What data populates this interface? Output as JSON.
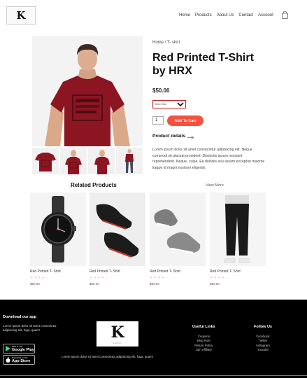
{
  "header": {
    "logo_text": "K",
    "nav": [
      "Home",
      "Products",
      "About Us",
      "Contact",
      "Account"
    ],
    "cart_icon": "shopping-bag-icon"
  },
  "product": {
    "breadcrumb": "Home / T- shirt",
    "title": "Red Printed T-Shirt by HRX",
    "price": "$50.00",
    "size_select": "Select Size",
    "quantity": "1",
    "add_to_cart": "Add To Cart",
    "details_heading": "Product details",
    "description": "Lorem ipsum dolor sit amet consectetur adipisicing elit. Neque commodi sit placeat provident! Distinctio ipsum nesciunt reprehenderit. Neque, culpa. Ea dolores eius ipsam excepturi maxime itaque id magni nostrum eligendi.",
    "colors": {
      "shirt": "#8c1522",
      "accent": "#f4513e",
      "select_border": "#c62828"
    }
  },
  "related": {
    "title": "Related Products",
    "view_more": "View More",
    "items": [
      {
        "name": "Red Printed T- Shirt",
        "price": "$50.00",
        "rating": 4
      },
      {
        "name": "Red Printed T- Shirt",
        "price": "$50.00",
        "rating": 4
      },
      {
        "name": "Red Printed T- Shirt",
        "price": "$50.00",
        "rating": 4
      },
      {
        "name": "Red Printed T- Shirt",
        "price": "$50.00",
        "rating": 4
      }
    ]
  },
  "footer": {
    "app_heading": "Download our app",
    "app_text": "Lorem ipsum dolor sit amet consectetur adipisicing elit, fuga, quam!",
    "google_play_small": "GET IT ON",
    "google_play": "Google Play",
    "app_store_small": "Download on the",
    "app_store": "App Store",
    "logo_text": "K",
    "logo_sub": "LOGO",
    "center_text": "Lorem ipsum dolor sit amet consectetur adipisicing elit, fuga, quam!",
    "useful_links_heading": "Useful Links",
    "useful_links": [
      "Coupons",
      "Blog Post",
      "Return Policy",
      "Join Affiliate"
    ],
    "follow_heading": "Follow Us",
    "follow_links": [
      "Facebook",
      "Twitter",
      "Instagram",
      "Youtube"
    ]
  }
}
